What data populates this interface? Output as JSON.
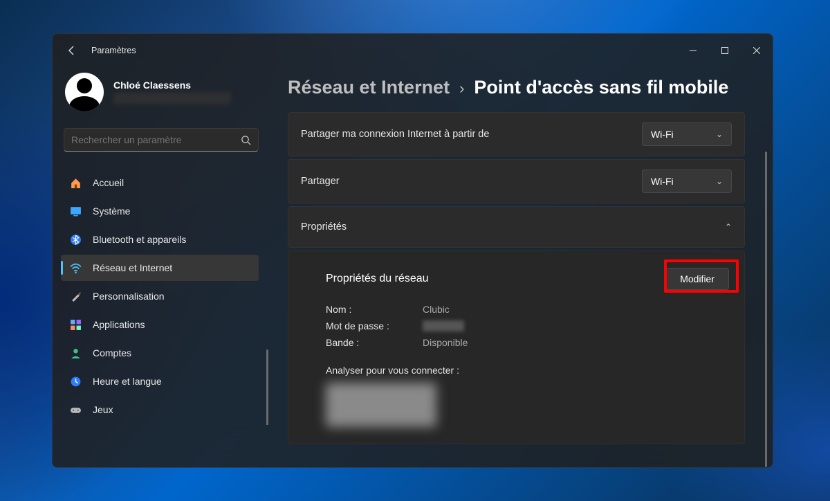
{
  "titlebar": {
    "title": "Paramètres"
  },
  "profile": {
    "name": "Chloé Claessens"
  },
  "search": {
    "placeholder": "Rechercher un paramètre"
  },
  "sidebar": {
    "items": [
      {
        "id": "home",
        "label": "Accueil"
      },
      {
        "id": "system",
        "label": "Système"
      },
      {
        "id": "bluetooth",
        "label": "Bluetooth et appareils"
      },
      {
        "id": "network",
        "label": "Réseau et Internet",
        "active": true
      },
      {
        "id": "personal",
        "label": "Personnalisation"
      },
      {
        "id": "apps",
        "label": "Applications"
      },
      {
        "id": "accounts",
        "label": "Comptes"
      },
      {
        "id": "time",
        "label": "Heure et langue"
      },
      {
        "id": "gaming",
        "label": "Jeux"
      }
    ]
  },
  "breadcrumb": {
    "root": "Réseau et Internet",
    "leaf": "Point d'accès sans fil mobile"
  },
  "cards": {
    "share_from": {
      "label": "Partager ma connexion Internet à partir de",
      "value": "Wi-Fi"
    },
    "share_over": {
      "label": "Partager",
      "value": "Wi-Fi"
    },
    "properties": {
      "title": "Propriétés",
      "section_title": "Propriétés du réseau",
      "modify_label": "Modifier",
      "name_label": "Nom :",
      "name_value": "Clubic",
      "password_label": "Mot de passe :",
      "password_value": "",
      "band_label": "Bande :",
      "band_value": "Disponible",
      "analyse_label": "Analyser pour vous connecter :"
    }
  },
  "colors": {
    "accent": "#4cc2ff",
    "highlight": "#ff0000"
  }
}
